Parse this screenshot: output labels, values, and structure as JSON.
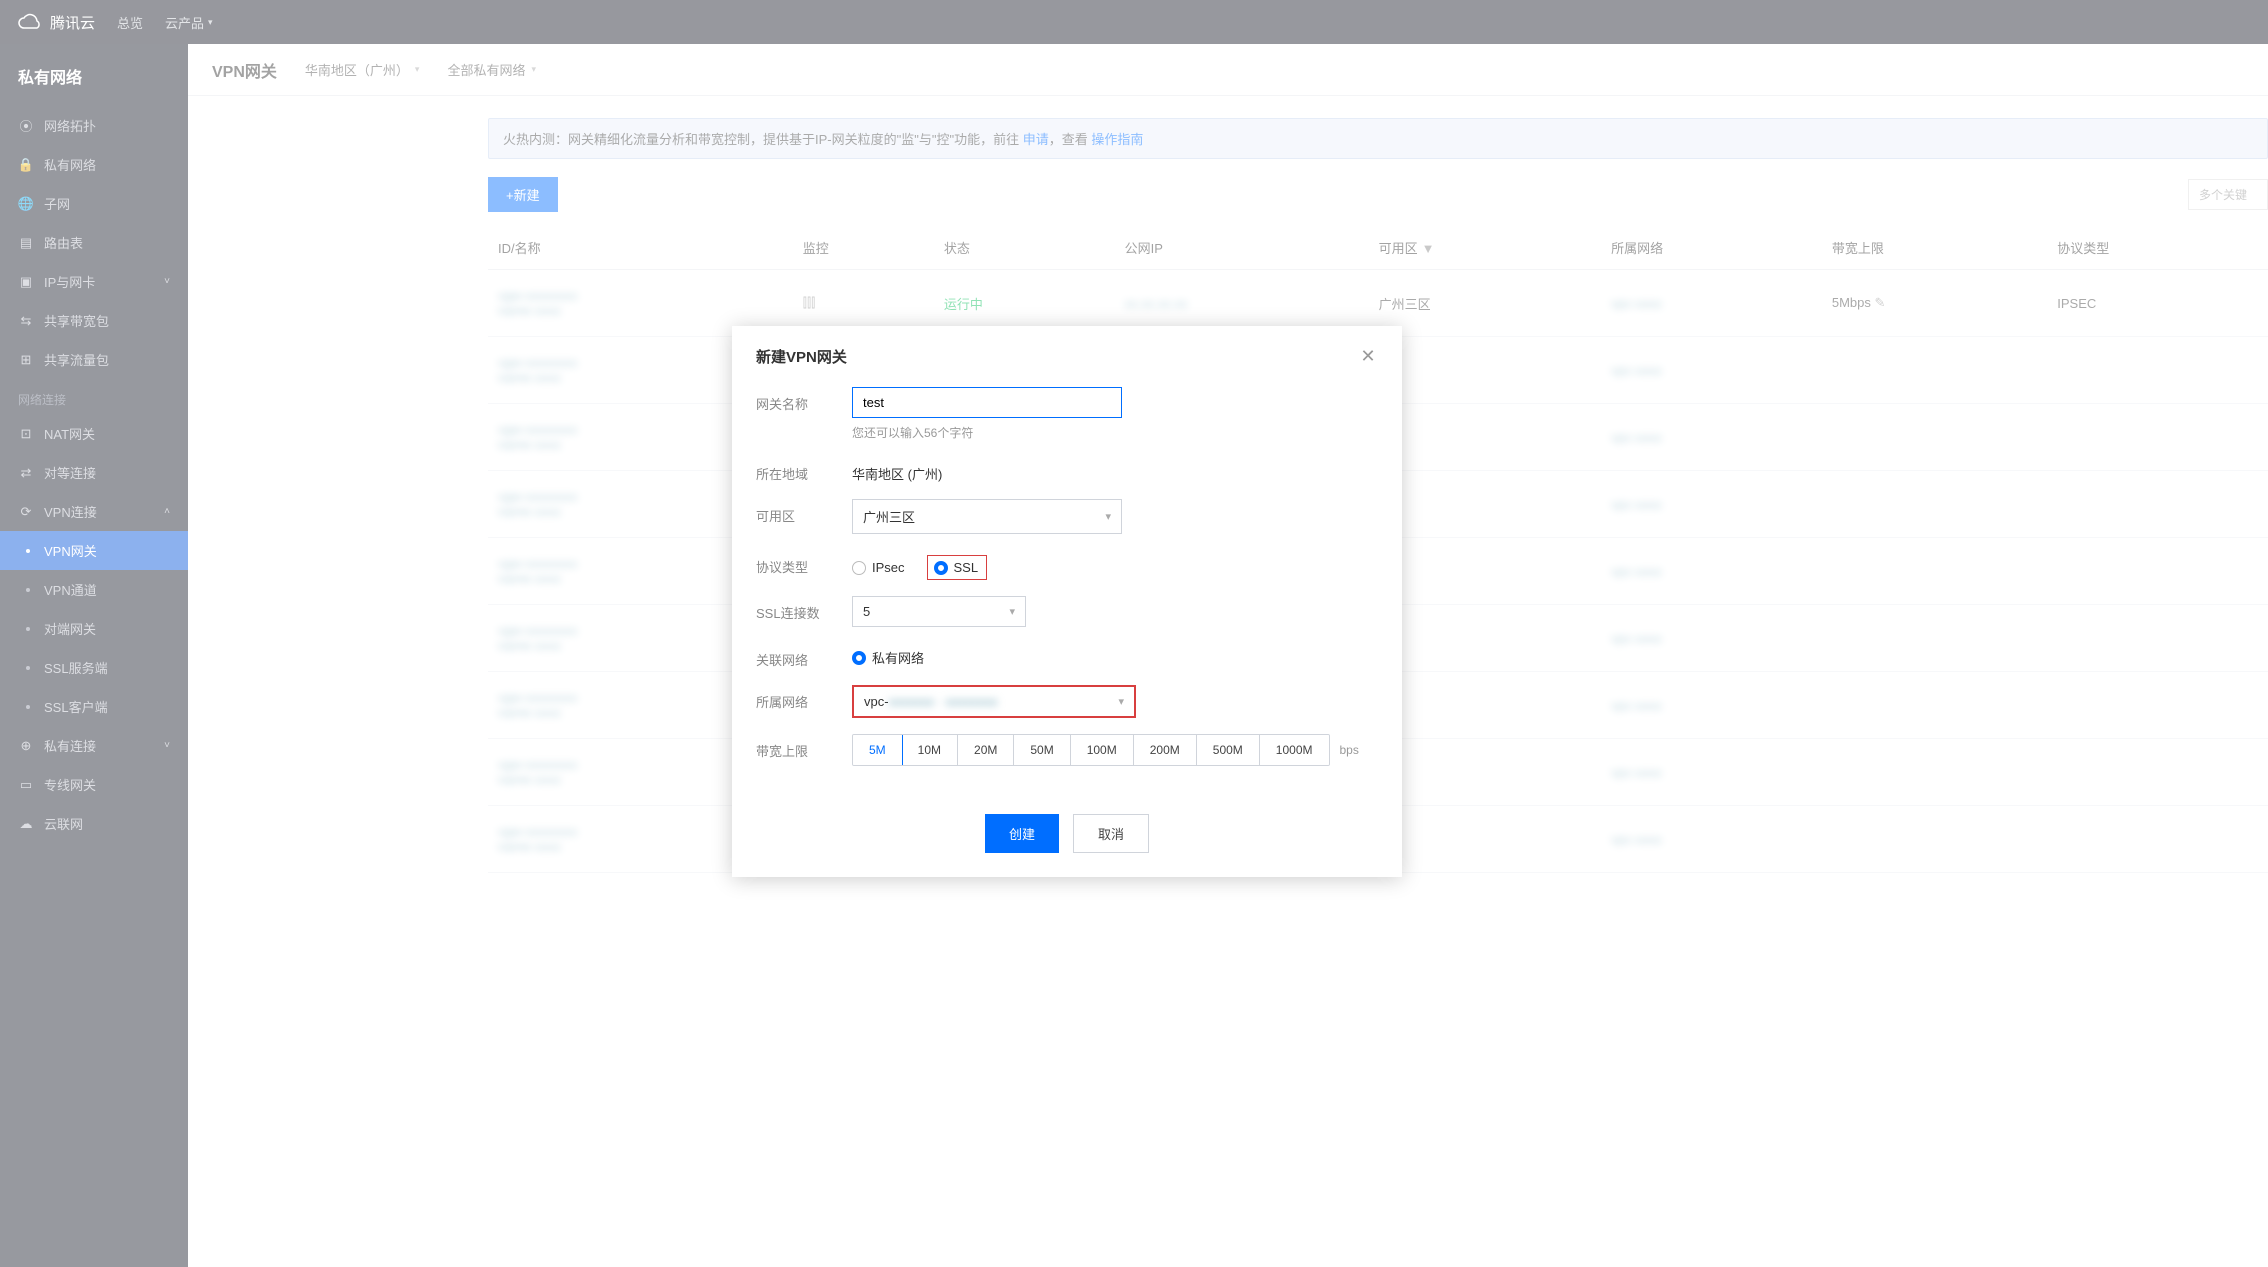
{
  "top": {
    "brand": "腾讯云",
    "overview": "总览",
    "products": "云产品"
  },
  "sidebar": {
    "title": "私有网络",
    "items": [
      {
        "icon": "topology",
        "label": "网络拓扑"
      },
      {
        "icon": "lock",
        "label": "私有网络"
      },
      {
        "icon": "globe",
        "label": "子网"
      },
      {
        "icon": "table",
        "label": "路由表"
      },
      {
        "icon": "nic",
        "label": "IP与网卡",
        "expand": true
      },
      {
        "icon": "bw",
        "label": "共享带宽包"
      },
      {
        "icon": "traffic",
        "label": "共享流量包"
      }
    ],
    "group": "网络连接",
    "items2": [
      {
        "icon": "nat",
        "label": "NAT网关"
      },
      {
        "icon": "peer",
        "label": "对等连接"
      },
      {
        "icon": "vpn",
        "label": "VPN连接",
        "expand": true,
        "open": true
      }
    ],
    "subs": [
      {
        "label": "VPN网关",
        "active": true
      },
      {
        "label": "VPN通道"
      },
      {
        "label": "对端网关"
      },
      {
        "label": "SSL服务端"
      },
      {
        "label": "SSL客户端"
      }
    ],
    "items3": [
      {
        "icon": "pvt",
        "label": "私有连接",
        "expand": true
      },
      {
        "icon": "dc",
        "label": "专线网关"
      },
      {
        "icon": "ccn",
        "label": "云联网"
      }
    ]
  },
  "main": {
    "title": "VPN网关",
    "region": "华南地区（广州）",
    "net": "全部私有网络",
    "notice_pre": "火热内测：网关精细化流量分析和带宽控制，提供基于IP-网关粒度的\"监\"与\"控\"功能，前往 ",
    "notice_link1": "申请",
    "notice_mid": "，查看 ",
    "notice_link2": "操作指南",
    "btn_new": "+新建",
    "search_ph": "多个关键",
    "cols": [
      "ID/名称",
      "监控",
      "状态",
      "公网IP",
      "可用区",
      "所属网络",
      "带宽上限",
      "协议类型"
    ],
    "filter_col": "可用区",
    "rows": [
      {
        "status": "运行中",
        "zone": "广州三区",
        "bw": "5Mbps",
        "proto": "IPSEC"
      },
      {},
      {},
      {},
      {},
      {},
      {},
      {},
      {}
    ]
  },
  "modal": {
    "title": "新建VPN网关",
    "name_label": "网关名称",
    "name_value": "test",
    "name_hint": "您还可以输入56个字符",
    "region_label": "所在地域",
    "region_value": "华南地区 (广州)",
    "zone_label": "可用区",
    "zone_value": "广州三区",
    "proto_label": "协议类型",
    "proto_ipsec": "IPsec",
    "proto_ssl": "SSL",
    "sslconn_label": "SSL连接数",
    "sslconn_value": "5",
    "assoc_label": "关联网络",
    "assoc_vpc": "私有网络",
    "vpc_label": "所属网络",
    "vpc_value": "vpc-",
    "bw_label": "带宽上限",
    "bw_options": [
      "5M",
      "10M",
      "20M",
      "50M",
      "100M",
      "200M",
      "500M",
      "1000M"
    ],
    "bw_unit": "bps",
    "ok": "创建",
    "cancel": "取消"
  }
}
